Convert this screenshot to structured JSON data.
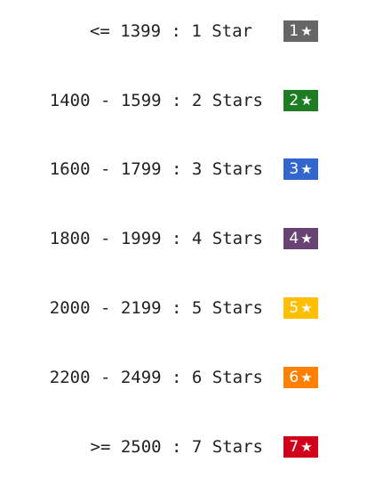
{
  "ratings": [
    {
      "range": "<= 1399 : 1 Star",
      "badge_number": "1",
      "star_icon": "star-icon",
      "color": "#666666"
    },
    {
      "range": "1400 - 1599 : 2 Stars",
      "badge_number": "2",
      "star_icon": "star-icon",
      "color": "#1e7d22"
    },
    {
      "range": "1600 - 1799 : 3 Stars",
      "badge_number": "3",
      "star_icon": "star-icon",
      "color": "#3366cc"
    },
    {
      "range": "1800 - 1999 : 4 Stars",
      "badge_number": "4",
      "star_icon": "star-icon",
      "color": "#684273"
    },
    {
      "range": "2000 - 2199 : 5 Stars",
      "badge_number": "5",
      "star_icon": "star-icon",
      "color": "#ffbf00"
    },
    {
      "range": "2200 - 2499 : 6 Stars",
      "badge_number": "6",
      "star_icon": "star-icon",
      "color": "#ff7f00"
    },
    {
      "range": ">= 2500 : 7 Stars",
      "badge_number": "7",
      "star_icon": "star-icon",
      "color": "#d0011b"
    }
  ]
}
